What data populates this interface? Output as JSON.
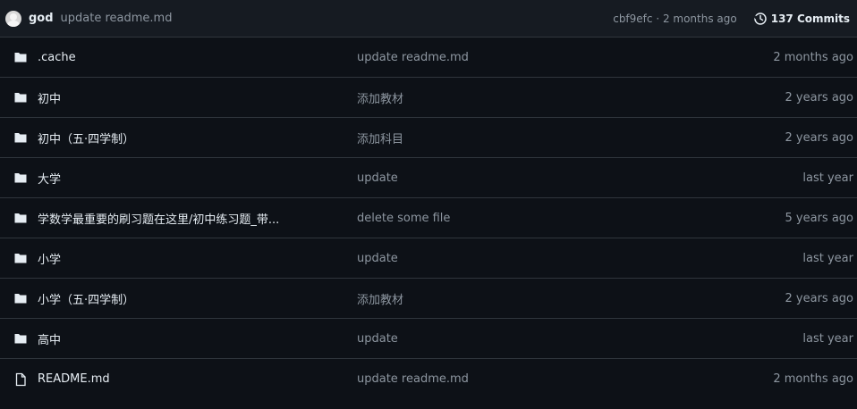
{
  "latest_commit": {
    "author": "god",
    "message": "update readme.md",
    "meta": "cbf9efc · 2 months ago",
    "commits_label": "137 Commits"
  },
  "colors": {
    "background": "#0d1117",
    "header_bg": "#161b22",
    "border": "#30363d",
    "text": "#e6edf3",
    "muted": "#8d96a0"
  },
  "files": [
    {
      "type": "folder",
      "name": ".cache",
      "message": "update readme.md",
      "date": "2 months ago"
    },
    {
      "type": "folder",
      "name": "初中",
      "message": "添加教材",
      "date": "2 years ago"
    },
    {
      "type": "folder",
      "name": "初中（五·四学制）",
      "message": "添加科目",
      "date": "2 years ago"
    },
    {
      "type": "folder",
      "name": "大学",
      "message": "update",
      "date": "last year"
    },
    {
      "type": "folder",
      "name": "学数学最重要的刷习题在这里/初中练习题_带...",
      "message": "delete some file",
      "date": "5 years ago"
    },
    {
      "type": "folder",
      "name": "小学",
      "message": "update",
      "date": "last year"
    },
    {
      "type": "folder",
      "name": "小学（五·四学制）",
      "message": "添加教材",
      "date": "2 years ago"
    },
    {
      "type": "folder",
      "name": "高中",
      "message": "update",
      "date": "last year"
    },
    {
      "type": "file",
      "name": "README.md",
      "message": "update readme.md",
      "date": "2 months ago"
    }
  ]
}
